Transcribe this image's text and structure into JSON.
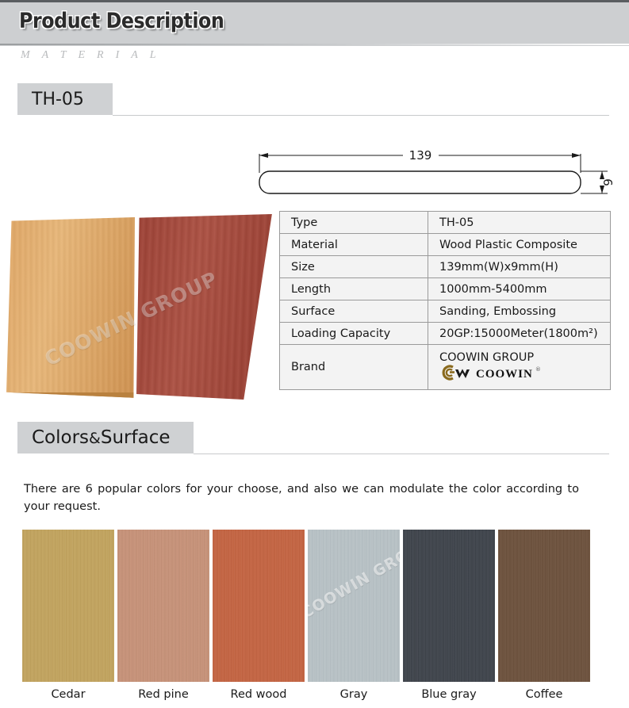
{
  "header": {
    "title": "Product Description",
    "subtitle": "MATERIAL"
  },
  "sections": {
    "model": {
      "badge_label": "TH-05"
    },
    "colors": {
      "badge_label_main": "Colors",
      "badge_label_amp": "&",
      "badge_label_tail": "Surface",
      "description": "There are 6 popular colors for your choose, and also we can modulate the color according to your request."
    }
  },
  "drawing": {
    "width_dimension": "139",
    "height_dimension": "9"
  },
  "photo": {
    "watermark": "COOWIN GROUP",
    "board_left_color": "#e3ab6b",
    "board_right_color": "#a34a3c"
  },
  "spec_table": {
    "rows": [
      {
        "key": "Type",
        "value": "TH-05"
      },
      {
        "key": "Material",
        "value": "Wood Plastic Composite"
      },
      {
        "key": "Size",
        "value": "139mm(W)x9mm(H)"
      },
      {
        "key": "Length",
        "value": "1000mm-5400mm"
      },
      {
        "key": "Surface",
        "value": "Sanding, Embossing"
      },
      {
        "key": "Loading Capacity",
        "value": "20GP:15000Meter(1800m²)"
      }
    ],
    "brand": {
      "key": "Brand",
      "company": "COOWIN GROUP",
      "logo_word": "COOWIN",
      "logo_registered": "®",
      "logo_color": "#8a6a1e"
    }
  },
  "swatches": [
    {
      "label": "Cedar",
      "color": "#c2a35c",
      "watermark": ""
    },
    {
      "label": "Red pine",
      "color": "#c79177",
      "watermark": ""
    },
    {
      "label": "Red wood",
      "color": "#c4623f",
      "watermark": ""
    },
    {
      "label": "Gray",
      "color": "#b8c2c6",
      "watermark": "COOWIN GROUP"
    },
    {
      "label": "Blue gray",
      "color": "#3c4149",
      "watermark": ""
    },
    {
      "label": "Coffee",
      "color": "#6b4f3a",
      "watermark": ""
    }
  ]
}
